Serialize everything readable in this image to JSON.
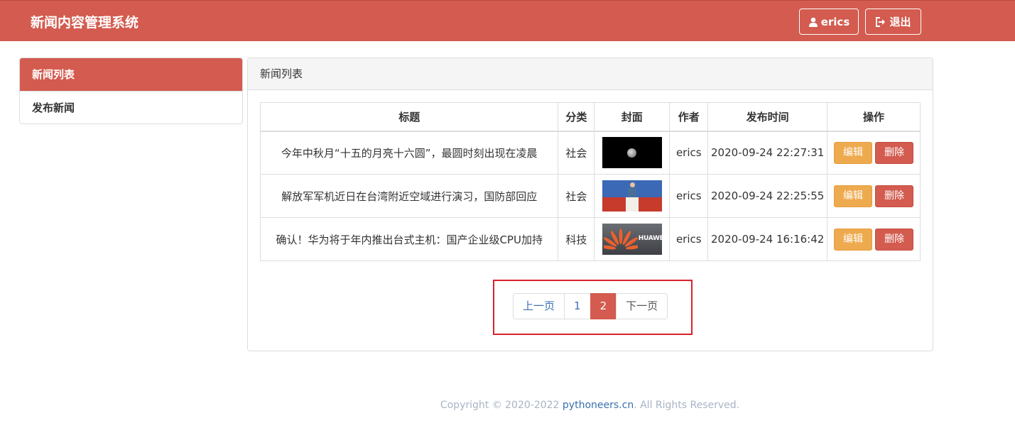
{
  "navbar": {
    "brand": "新闻内容管理系统",
    "user_label": "erics",
    "logout_label": "退出",
    "user_icon": "user-icon",
    "logout_icon": "logout-icon"
  },
  "sidebar": {
    "items": [
      {
        "label": "新闻列表",
        "active": true
      },
      {
        "label": "发布新闻",
        "active": false
      }
    ]
  },
  "panel": {
    "title": "新闻列表"
  },
  "table": {
    "headers": [
      "标题",
      "分类",
      "封面",
      "作者",
      "发布时间",
      "操作"
    ],
    "rows": [
      {
        "title": "今年中秋月“十五的月亮十六圆”，最圆时刻出现在凌晨",
        "category": "社会",
        "cover": "moon-image",
        "author": "erics",
        "time": "2020-09-24 22:27:31",
        "edit": "编辑",
        "delete": "删除"
      },
      {
        "title": "解放军军机近日在台湾附近空域进行演习，国防部回应",
        "category": "社会",
        "cover": "press-conference-image",
        "author": "erics",
        "time": "2020-09-24 22:25:55",
        "edit": "编辑",
        "delete": "删除"
      },
      {
        "title": "确认！华为将于年内推出台式主机：国产企业级CPU加持",
        "category": "科技",
        "cover": "huawei-logo-image",
        "author": "erics",
        "time": "2020-09-24 16:16:42",
        "edit": "编辑",
        "delete": "删除"
      }
    ]
  },
  "pagination": {
    "prev": "上一页",
    "pages": [
      "1",
      "2"
    ],
    "current": "2",
    "next": "下一页"
  },
  "footer": {
    "prefix": "Copyright © 2020-2022 ",
    "link": "pythoneers.cn",
    "suffix": ". All Rights Reserved."
  },
  "colors": {
    "primary": "#d35b4f",
    "warning": "#eeaa4e",
    "link": "#3a70b0",
    "highlight": "#d9222a"
  }
}
